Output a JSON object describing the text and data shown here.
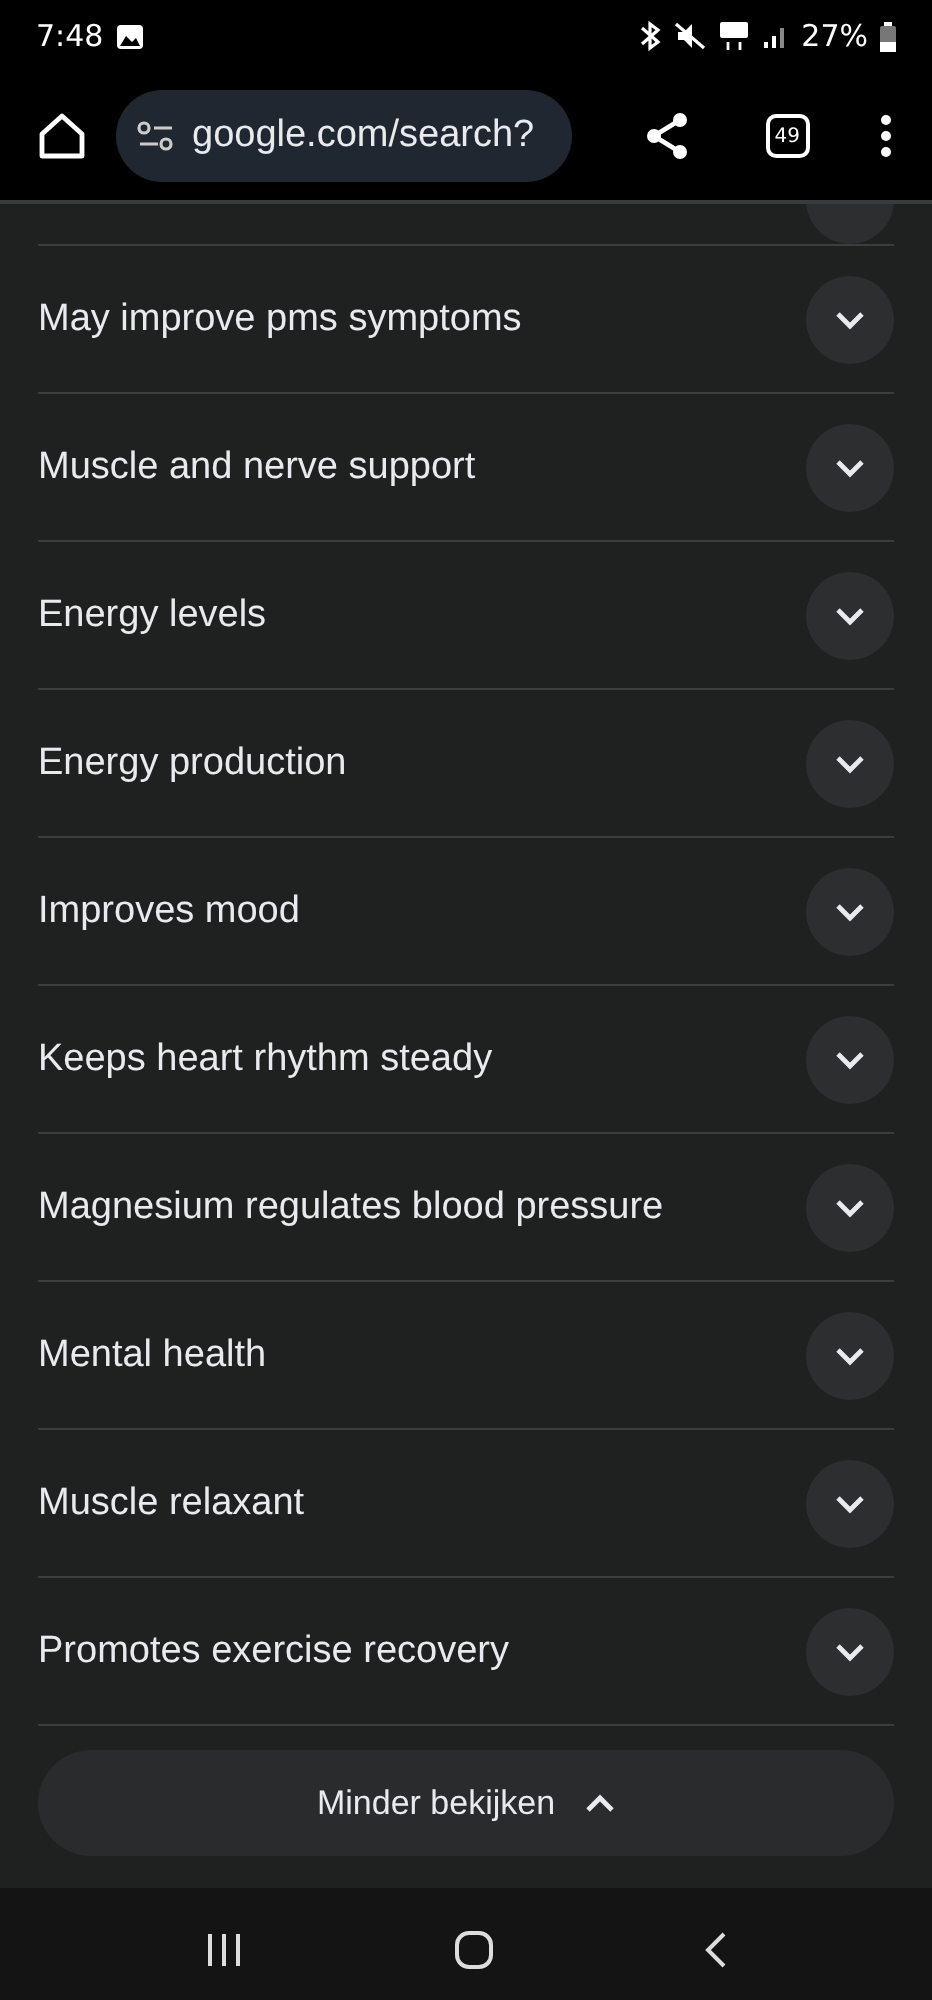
{
  "status_bar": {
    "time": "7:48",
    "battery": "27%"
  },
  "browser": {
    "url": "google.com/search?",
    "tab_count": "49"
  },
  "items": [
    {
      "label": "May improve pms symptoms",
      "expanded": false
    },
    {
      "label": "Muscle and nerve support",
      "expanded": false
    },
    {
      "label": "Energy levels",
      "expanded": false
    },
    {
      "label": "Energy production",
      "expanded": false
    },
    {
      "label": "Improves mood",
      "expanded": false
    },
    {
      "label": "Keeps heart rhythm steady",
      "expanded": false
    },
    {
      "label": "Magnesium regulates blood pressure",
      "expanded": false
    },
    {
      "label": "Mental health",
      "expanded": false
    },
    {
      "label": "Muscle relaxant",
      "expanded": false
    },
    {
      "label": "Promotes exercise recovery",
      "expanded": false
    }
  ],
  "show_less_button": {
    "label": "Minder bekijken"
  }
}
